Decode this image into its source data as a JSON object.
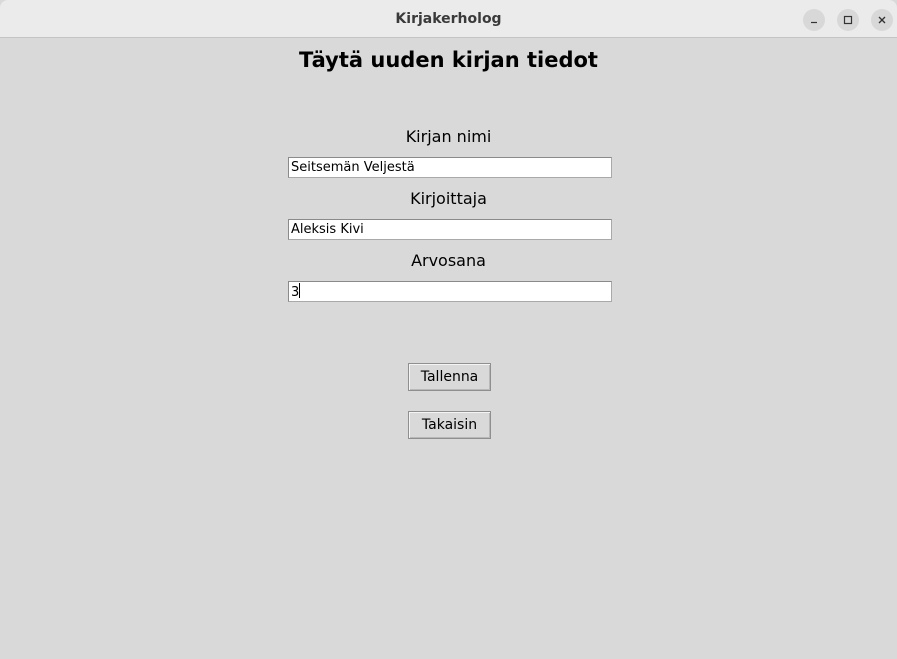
{
  "window": {
    "title": "Kirjakerholog"
  },
  "form": {
    "heading": "Täytä uuden kirjan tiedot",
    "fields": [
      {
        "label": "Kirjan nimi",
        "value": "Seitsemän Veljestä"
      },
      {
        "label": "Kirjoittaja",
        "value": "Aleksis Kivi"
      },
      {
        "label": "Arvosana",
        "value": "3"
      }
    ],
    "buttons": {
      "save_label": "Tallenna",
      "back_label": "Takaisin"
    }
  },
  "icons": {
    "minimize": "minimize-icon",
    "maximize": "maximize-icon",
    "close": "close-icon"
  }
}
